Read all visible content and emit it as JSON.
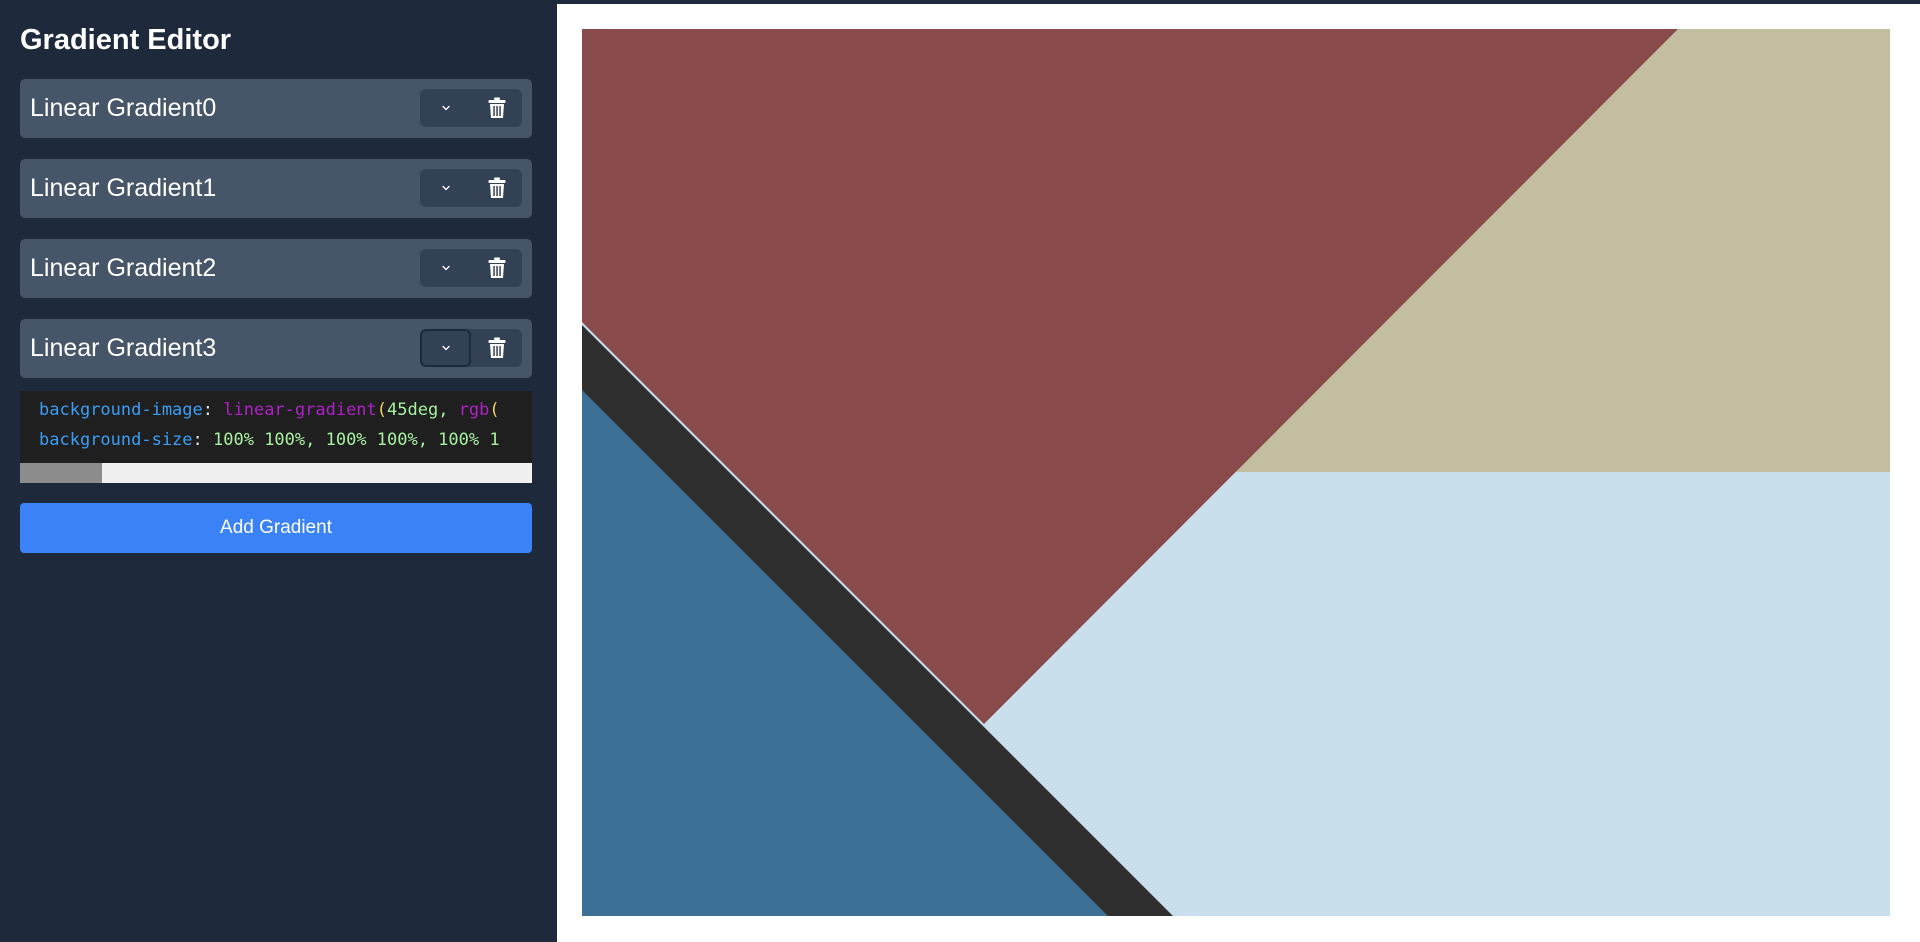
{
  "sidebar": {
    "title": "Gradient Editor",
    "items": [
      {
        "label": "Linear Gradient0",
        "expanded": false
      },
      {
        "label": "Linear Gradient1",
        "expanded": false
      },
      {
        "label": "Linear Gradient2",
        "expanded": false
      },
      {
        "label": "Linear Gradient3",
        "expanded": true
      }
    ],
    "code": {
      "line1": {
        "property": "background-image",
        "colon": ": ",
        "function": "linear-gradient",
        "paren": "(",
        "args": "45deg, ",
        "inner_function": "rgb",
        "inner_paren": "("
      },
      "line2": {
        "property": "background-size",
        "colon": ": ",
        "values": "100% 100%, 100% 100%, 100% 1"
      },
      "horizontal_scroll_fraction": 0.16
    },
    "add_button_label": "Add Gradient"
  },
  "preview": {
    "colors": {
      "maroon": "#884a4a",
      "tan": "#c4bea0",
      "light_blue": "#c9e0ec",
      "steel_blue": "#3d7095",
      "charcoal": "#2f2f2f",
      "frame": "#ffffff"
    }
  },
  "icons": {
    "toggle": "chevron-down-icon",
    "delete": "trash-icon"
  },
  "theme": {
    "background": "#1e293b",
    "item_bg": "#475569",
    "button_group_bg": "#334155",
    "accent": "#3b82f6"
  }
}
